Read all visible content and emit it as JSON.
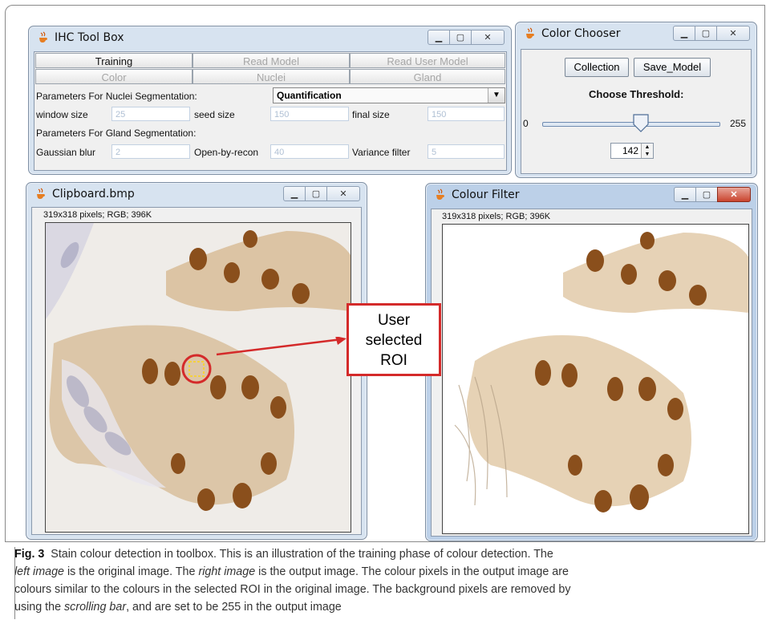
{
  "ihc_toolbox": {
    "title": "IHC Tool Box",
    "row1": [
      "Training",
      "Read Model",
      "Read User Model"
    ],
    "row2": [
      "Color",
      "Nuclei",
      "Gland"
    ],
    "nuclei_param_label": "Parameters For Nuclei Segmentation:",
    "mode_selected": "Quantification",
    "window_size_label": "window size",
    "window_size_value": "25",
    "seed_size_label": "seed size",
    "seed_size_value": "150",
    "final_size_label": "final size",
    "final_size_value": "150",
    "gland_param_label": "Parameters For Gland Segmentation:",
    "gaussian_label": "Gaussian blur",
    "gaussian_value": "2",
    "open_label": "Open-by-recon",
    "open_value": "40",
    "variance_label": "Variance filter",
    "variance_value": "5"
  },
  "color_chooser": {
    "title": "Color Chooser",
    "collection_label": "Collection",
    "save_model_label": "Save_Model",
    "threshold_label": "Choose Threshold:",
    "slider_min": "0",
    "slider_max": "255",
    "slider_value": 142,
    "spinner_value": "142"
  },
  "clipboard_window": {
    "title": "Clipboard.bmp",
    "info": "319x318 pixels; RGB; 396K"
  },
  "colour_filter_window": {
    "title": "Colour Filter",
    "info": "319x318 pixels; RGB; 396K"
  },
  "annotation": {
    "line1": "User",
    "line2": "selected",
    "line3": "ROI",
    "color": "#d42a2a"
  },
  "caption": {
    "fig_label": "Fig. 3",
    "part1": "Stain colour detection in toolbox. This is an illustration of the training phase of colour detection. The",
    "left_image_em": "left image",
    "part2": "is the original image. The",
    "right_image_em": "right image",
    "part3": "is the output image. The colour pixels in the output image are",
    "line3": "colours similar to the colours in the selected ROI in the original image. The background pixels are removed by",
    "part4": "using the",
    "scrolling_em": "scrolling bar",
    "part5": ", and are set to be 255 in the output image"
  }
}
